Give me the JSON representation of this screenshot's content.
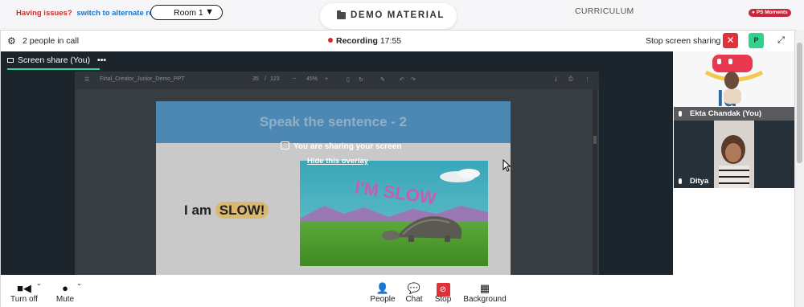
{
  "topbar": {
    "issues_text": "Having issues?",
    "switch_link": "switch to alternate room",
    "room_select": "Room 1",
    "demo_material": "DEMO MATERIAL",
    "curriculum": "CURRICULUM",
    "ps_badge": "PS Moments"
  },
  "call_header": {
    "people_count": "2 people in call",
    "recording_label": "Recording",
    "recording_time": "17:55",
    "stop_sharing": "Stop screen sharing",
    "participant_initial": "P"
  },
  "stage": {
    "tab_label": "Screen share (You)",
    "tab_menu": "•••",
    "pdf": {
      "filename": "Final_Creator_Junior_Demo_PPT",
      "page": "35",
      "total_pages": "123",
      "zoom": "45%"
    },
    "slide": {
      "title": "Speak the sentence - 2",
      "sentence_prefix": "I am",
      "sentence_highlight": "SLOW!",
      "image_caption": "I'M SLOW"
    },
    "overlay": {
      "message": "You are sharing your screen",
      "hide_link": "Hide this overlay"
    }
  },
  "participants": [
    {
      "name": "Ekta Chandak (You)"
    },
    {
      "name": "Ditya"
    }
  ],
  "controls": [
    {
      "label": "Turn off",
      "icon": "camera-icon"
    },
    {
      "label": "Mute",
      "icon": "mic-icon"
    },
    {
      "label": "People",
      "icon": "people-icon"
    },
    {
      "label": "Chat",
      "icon": "chat-icon"
    },
    {
      "label": "Stop",
      "icon": "stop-share-icon"
    },
    {
      "label": "Background",
      "icon": "background-icon"
    }
  ],
  "colors": {
    "accent_green": "#2fd4a0",
    "record_red": "#d52b2b",
    "stop_red": "#e0303a",
    "stage_bg": "#1d252c"
  }
}
